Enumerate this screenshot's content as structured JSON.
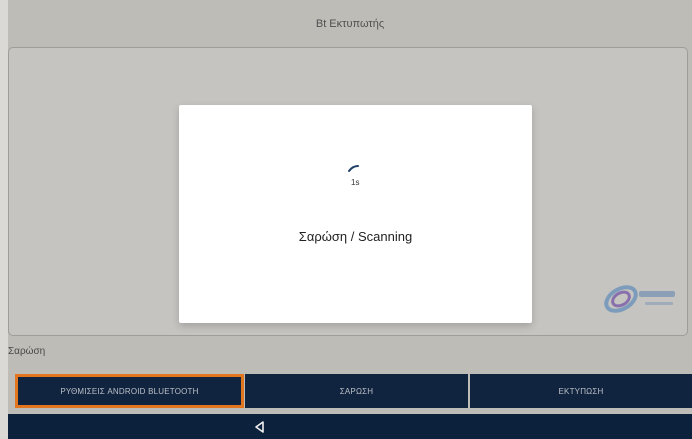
{
  "header": {
    "title": "Bt Εκτυπωτής"
  },
  "section": {
    "label": "Σαρώση"
  },
  "buttons": {
    "android_settings": "ΡΥΘΜΙΣΕΙΣ ANDROID BLUETOOTH",
    "scan": "ΣΑΡΩΣΗ",
    "print": "ΕΚΤΥΠΩΣΗ"
  },
  "dialog": {
    "timer": "1s",
    "message": "Σαρώση / Scanning"
  },
  "icons": {
    "back": "back-triangle-icon",
    "spinner": "loading-spinner-icon",
    "logo": "brand-logo-icon"
  },
  "colors": {
    "background": "#c9c8c3",
    "button": "#132743",
    "highlight": "#f07d22",
    "nav": "#0d2440",
    "dialog": "#ffffff"
  }
}
